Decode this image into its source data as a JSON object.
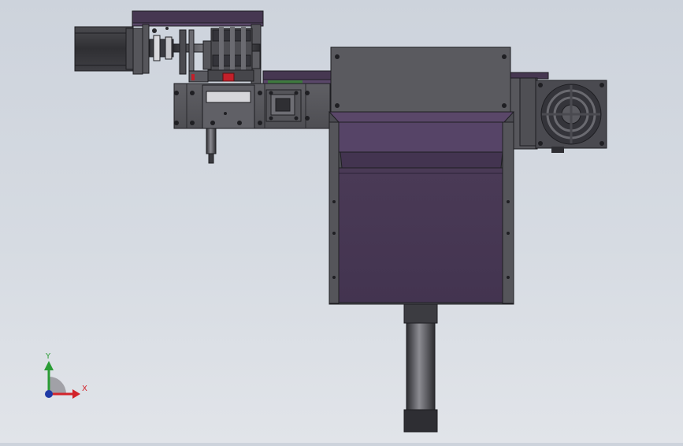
{
  "view": {
    "background_top": "#cdd3dc",
    "background_bottom": "#e1e4e9"
  },
  "colors": {
    "purple_dark": "#463751",
    "purple_mid": "#5a4769",
    "steel_dark": "#3e3e42",
    "steel_mid": "#5b5b60",
    "steel_light": "#8a8a90",
    "red_part": "#c3202a",
    "outline": "#1e1e22"
  },
  "triad": {
    "x_label": "X",
    "y_label": "Y",
    "x_color": "#d2232a",
    "y_color": "#2a9c35",
    "z_color": "#1f3aa6"
  },
  "components": {
    "motor": "stepper-motor",
    "fan": "cooling-fan",
    "cylinder": "pneumatic-cylinder",
    "hopper": "hopper-body"
  }
}
